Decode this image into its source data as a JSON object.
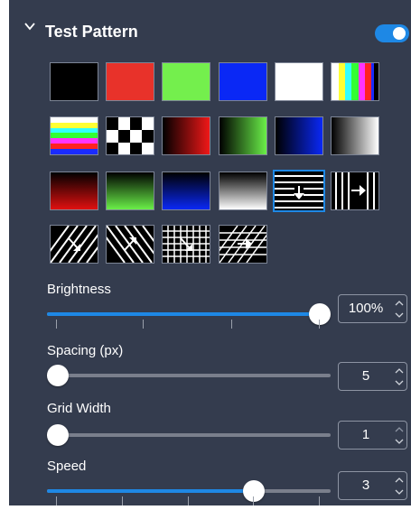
{
  "header": {
    "title": "Test Pattern",
    "enabled": true,
    "accent_color": "#1e88e5"
  },
  "patterns": [
    {
      "name": "solid-black",
      "selected": false
    },
    {
      "name": "solid-red",
      "selected": false
    },
    {
      "name": "solid-green",
      "selected": false
    },
    {
      "name": "solid-blue",
      "selected": false
    },
    {
      "name": "solid-white",
      "selected": false
    },
    {
      "name": "color-bars-vertical",
      "selected": false
    },
    {
      "name": "color-bars-horizontal",
      "selected": false
    },
    {
      "name": "checkerboard",
      "selected": false
    },
    {
      "name": "red-gradient-horizontal",
      "selected": false
    },
    {
      "name": "green-gradient-horizontal",
      "selected": false
    },
    {
      "name": "blue-gradient-horizontal",
      "selected": false
    },
    {
      "name": "gray-gradient-horizontal",
      "selected": false
    },
    {
      "name": "red-gradient-vertical",
      "selected": false
    },
    {
      "name": "green-gradient-vertical",
      "selected": false
    },
    {
      "name": "blue-gradient-vertical",
      "selected": false
    },
    {
      "name": "gray-gradient-vertical",
      "selected": false
    },
    {
      "name": "moving-lines-down",
      "selected": true
    },
    {
      "name": "moving-lines-right",
      "selected": false
    },
    {
      "name": "moving-diagonal-down-right",
      "selected": false
    },
    {
      "name": "moving-diagonal-up-right",
      "selected": false
    },
    {
      "name": "moving-grid-diagonal",
      "selected": false
    },
    {
      "name": "moving-diagonal-grid-right",
      "selected": false
    }
  ],
  "controls": {
    "brightness": {
      "label": "Brightness",
      "value": "100%",
      "level": 1.0
    },
    "spacing": {
      "label": "Spacing (px)",
      "value": "5",
      "level": 0.0
    },
    "grid_width": {
      "label": "Grid Width",
      "value": "1",
      "level": 0.0
    },
    "speed": {
      "label": "Speed",
      "value": "3",
      "level": 0.72
    }
  }
}
